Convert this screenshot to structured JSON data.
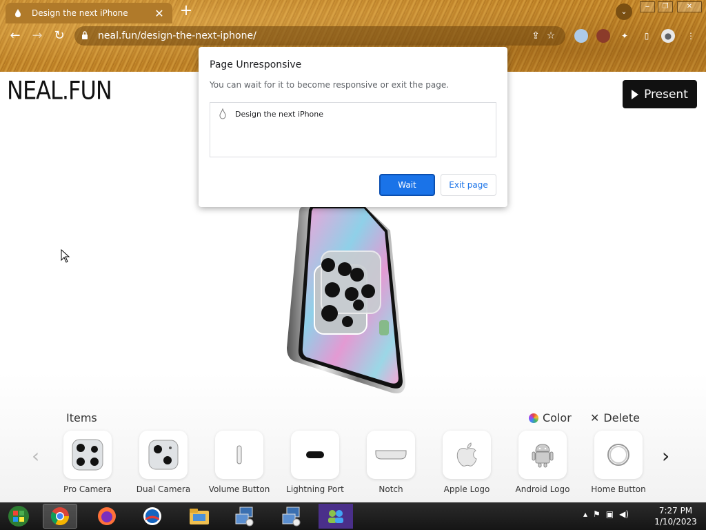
{
  "browser": {
    "tab_title": "Design the next iPhone",
    "tab_close": "✕",
    "new_tab": "+",
    "url": "neal.fun/design-the-next-iphone/"
  },
  "page": {
    "logo": "NEAL.FUN",
    "present_label": "Present"
  },
  "dialog": {
    "title": "Page Unresponsive",
    "message": "You can wait for it to become responsive or exit the page.",
    "page_item": "Design the next iPhone",
    "wait_label": "Wait",
    "exit_label": "Exit page"
  },
  "items_panel": {
    "title": "Items",
    "color_label": "Color",
    "delete_label": "Delete",
    "items": [
      {
        "label": "Pro Camera"
      },
      {
        "label": "Dual Camera"
      },
      {
        "label": "Volume Button"
      },
      {
        "label": "Lightning Port"
      },
      {
        "label": "Notch"
      },
      {
        "label": "Apple Logo"
      },
      {
        "label": "Android Logo"
      },
      {
        "label": "Home Button"
      }
    ]
  },
  "taskbar": {
    "time": "7:27 PM",
    "date": "1/10/2023"
  }
}
